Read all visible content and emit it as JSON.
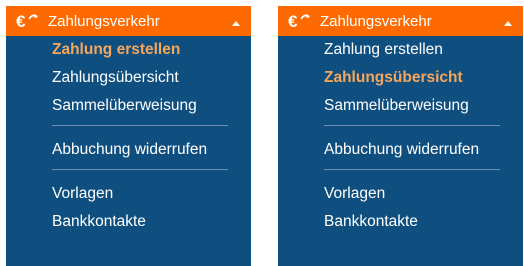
{
  "panels": [
    {
      "header": {
        "title": "Zahlungsverkehr",
        "icon": "euro-transfer-icon",
        "toggle_icon": "caret-up-icon"
      },
      "items": [
        {
          "label": "Zahlung erstellen",
          "active": true
        },
        {
          "label": "Zahlungsübersicht",
          "active": false
        },
        {
          "label": "Sammelüberweisung",
          "active": false
        },
        {
          "label": "Abbuchung widerrufen",
          "active": false
        },
        {
          "label": "Vorlagen",
          "active": false
        },
        {
          "label": "Bankkontakte",
          "active": false
        }
      ]
    },
    {
      "header": {
        "title": "Zahlungsverkehr",
        "icon": "euro-transfer-icon",
        "toggle_icon": "caret-up-icon"
      },
      "items": [
        {
          "label": "Zahlung erstellen",
          "active": false
        },
        {
          "label": "Zahlungsübersicht",
          "active": true
        },
        {
          "label": "Sammelüberweisung",
          "active": false
        },
        {
          "label": "Abbuchung widerrufen",
          "active": false
        },
        {
          "label": "Vorlagen",
          "active": false
        },
        {
          "label": "Bankkontakte",
          "active": false
        }
      ]
    }
  ],
  "colors": {
    "header_bg": "#ff6a00",
    "panel_bg": "#0f4f80",
    "active_text": "#f5a65b",
    "text": "#ffffff",
    "divider": "#6d8fae"
  }
}
